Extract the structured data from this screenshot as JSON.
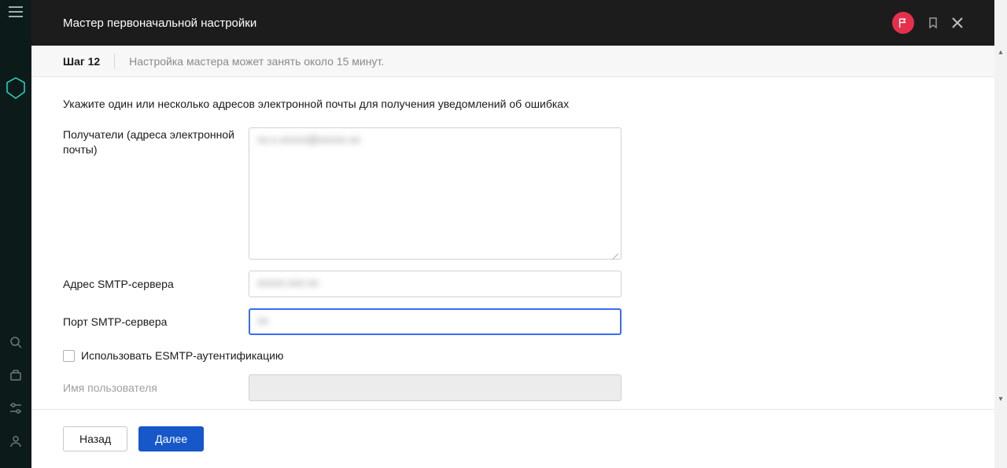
{
  "header": {
    "title": "Мастер первоначальной настройки"
  },
  "step": {
    "label": "Шаг 12",
    "hint": "Настройка мастера может занять около 15 минут."
  },
  "form": {
    "intro": "Укажите один или несколько адресов электронной почты для получения уведомлений об ошибках",
    "recipients_label": "Получатели (адреса электронной почты)",
    "recipients_value": "xx.x.xxxxx@xxxxx.xx",
    "smtp_addr_label": "Адрес SMTP-сервера",
    "smtp_addr_value": "xxxxx.xxx.xx",
    "smtp_port_label": "Порт SMTP-сервера",
    "smtp_port_value": "xx",
    "esmtp_label": "Использовать ESMTP-аутентификацию",
    "username_label": "Имя пользователя",
    "username_value": ""
  },
  "footer": {
    "back": "Назад",
    "next": "Далее"
  }
}
